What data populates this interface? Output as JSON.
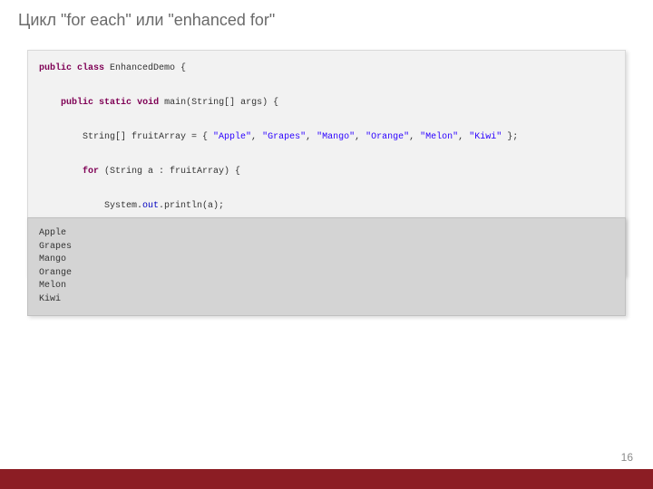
{
  "title": "Цикл \"for each\" или \"enhanced for\"",
  "page_number": "16",
  "code": {
    "kw_public1": "public",
    "kw_class": "class",
    "class_name": " EnhancedDemo {",
    "kw_public2": "public",
    "kw_static": "static",
    "kw_void": "void",
    "method_sig": " main(String[] args) {",
    "decl_pre": "        String[] fruitArray = { ",
    "s_apple": "\"Apple\"",
    "s_grapes": "\"Grapes\"",
    "s_mango": "\"Mango\"",
    "s_orange": "\"Orange\"",
    "s_melon": "\"Melon\"",
    "s_kiwi": "\"Kiwi\"",
    "decl_post": " };",
    "comma": ", ",
    "kw_for": "for",
    "for_sig": " (String a : fruitArray) {",
    "print_pre": "            System.",
    "fld_out": "out",
    "print_post": ".println(a);",
    "brace1": "        }",
    "brace2": "    }",
    "brace3": "}"
  },
  "output": "Apple\nGrapes\nMango\nOrange\nMelon\nKiwi"
}
